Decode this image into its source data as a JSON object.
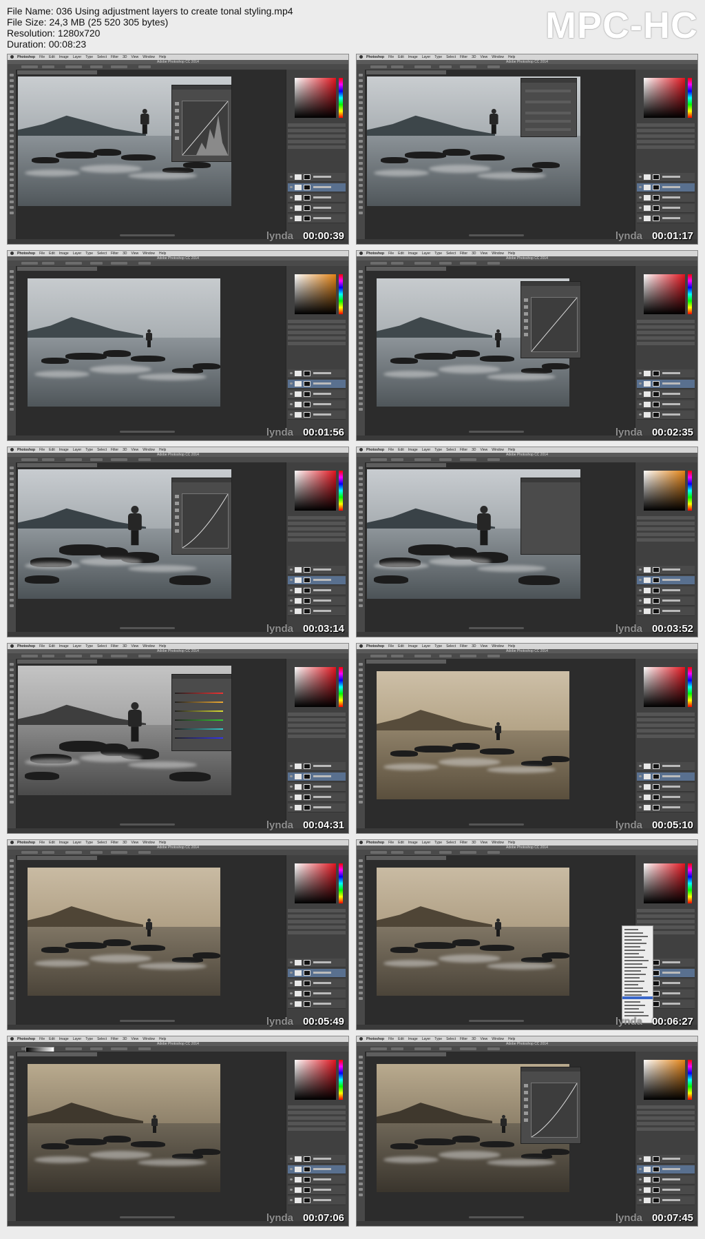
{
  "file_info": {
    "file_name": "File Name: 036 Using adjustment layers to create tonal styling.mp4",
    "file_size": "File Size: 24,3 MB (25 520 305 bytes)",
    "resolution": "Resolution: 1280x720",
    "duration": "Duration: 00:08:23"
  },
  "logo": "MPC-HC",
  "menu": [
    "Photoshop",
    "File",
    "Edit",
    "Image",
    "Layer",
    "Type",
    "Select",
    "Filter",
    "3D",
    "View",
    "Window",
    "Help"
  ],
  "window_title": "Adobe Photoshop CC 2014",
  "watermark": "lynda",
  "thumbnails": [
    {
      "time": "00:00:39",
      "scene": "grey",
      "panel": "curves-hist",
      "swatch": "red",
      "bw": false
    },
    {
      "time": "00:01:17",
      "scene": "grey",
      "panel": "mask",
      "swatch": "red",
      "bw": false
    },
    {
      "time": "00:01:56",
      "scene": "grey-small",
      "panel": "none",
      "swatch": "orange",
      "bw": false
    },
    {
      "time": "00:02:35",
      "scene": "grey-small",
      "panel": "curves",
      "swatch": "red",
      "bw": false
    },
    {
      "time": "00:03:14",
      "scene": "grey-zoom",
      "panel": "curves",
      "swatch": "red",
      "bw": false
    },
    {
      "time": "00:03:52",
      "scene": "grey-zoom",
      "panel": "empty",
      "swatch": "orange",
      "bw": false
    },
    {
      "time": "00:04:31",
      "scene": "bw-zoom",
      "panel": "bw",
      "swatch": "red",
      "bw": true
    },
    {
      "time": "00:05:10",
      "scene": "sepia",
      "panel": "none",
      "swatch": "red",
      "bw": false
    },
    {
      "time": "00:05:49",
      "scene": "sepia-small",
      "panel": "none",
      "swatch": "red",
      "bw": false
    },
    {
      "time": "00:06:27",
      "scene": "sepia-small",
      "panel": "menu",
      "swatch": "red",
      "bw": false
    },
    {
      "time": "00:07:06",
      "scene": "dark-sepia",
      "panel": "gradient",
      "swatch": "red",
      "bw": false
    },
    {
      "time": "00:07:45",
      "scene": "dark-sepia",
      "panel": "curves",
      "swatch": "orange",
      "bw": false
    }
  ]
}
